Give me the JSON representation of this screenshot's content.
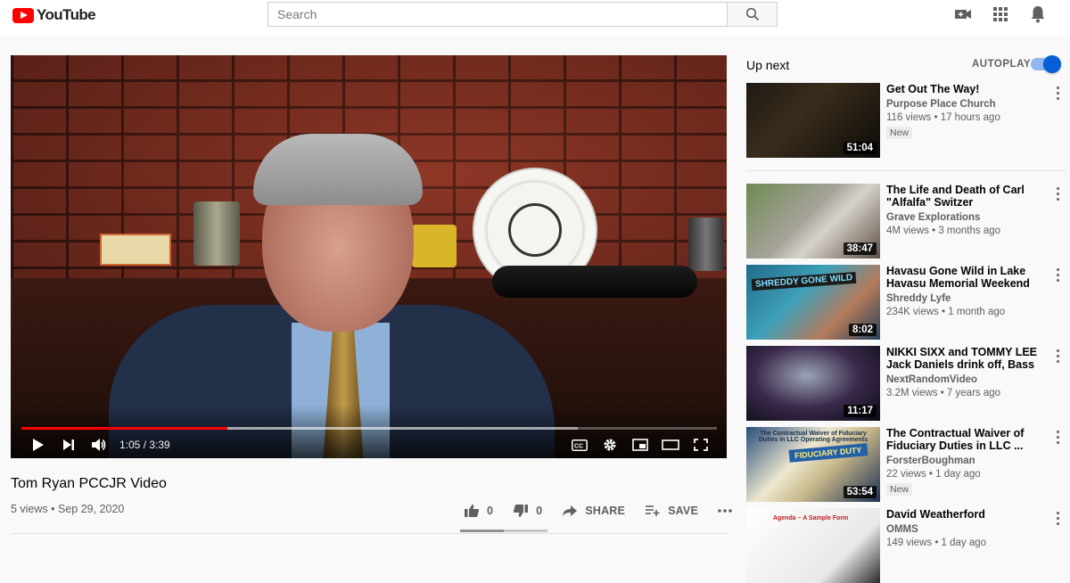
{
  "header": {
    "logo_text": "YouTube",
    "search_placeholder": "Search",
    "icons": [
      "create-video-icon",
      "apps-grid-icon",
      "notifications-bell-icon"
    ]
  },
  "player": {
    "current_time": "1:05 / 3:39",
    "played_fraction": 0.296,
    "loaded_fraction": 0.8,
    "controls": [
      "play-icon",
      "next-icon",
      "volume-icon",
      "captions-icon",
      "settings-gear-icon",
      "miniplayer-icon",
      "theater-mode-icon",
      "fullscreen-icon"
    ],
    "accent_color": "#ff0000"
  },
  "video": {
    "title": "Tom Ryan PCCJR Video",
    "meta": "5 views • Sep 29, 2020",
    "likes": "0",
    "dislikes": "0",
    "share_label": "SHARE",
    "save_label": "SAVE"
  },
  "sidebar": {
    "up_next_label": "Up next",
    "autoplay_label": "AUTOPLAY",
    "autoplay_on": true,
    "autoplay_color": "#065fd4",
    "items": [
      {
        "title": "Get Out The Way!",
        "channel": "Purpose Place Church",
        "stats": "116 views • 17 hours ago",
        "badge": "New",
        "duration": "51:04"
      },
      {
        "title": "The Life and Death of Carl \"Alfalfa\" Switzer",
        "channel": "Grave Explorations",
        "stats": "4M views • 3 months ago",
        "badge": "",
        "duration": "38:47"
      },
      {
        "title": "Havasu Gone Wild in Lake Havasu Memorial Weekend",
        "channel": "Shreddy Lyfe",
        "stats": "234K views • 1 month ago",
        "badge": "",
        "duration": "8:02",
        "thumb_text": "SHREDDY GONE WILD"
      },
      {
        "title": "NIKKI SIXX and TOMMY LEE Jack Daniels drink off, Bass ...",
        "channel": "NextRandomVideo",
        "stats": "3.2M views • 7 years ago",
        "badge": "",
        "duration": "11:17"
      },
      {
        "title": "The Contractual Waiver of Fiduciary Duties in LLC ...",
        "channel": "ForsterBoughman",
        "stats": "22 views • 1 day ago",
        "badge": "New",
        "duration": "53:54",
        "thumb_text": "The Contractual Waiver of Fiduciary Duties in LLC Operating Agreements",
        "thumb_text2": "FIDUCIARY DUTY"
      },
      {
        "title": "David Weatherford",
        "channel": "OMMS",
        "stats": "149 views • 1 day ago",
        "badge": "",
        "duration": "",
        "thumb_text": "Agenda – A Sample Form"
      }
    ]
  }
}
